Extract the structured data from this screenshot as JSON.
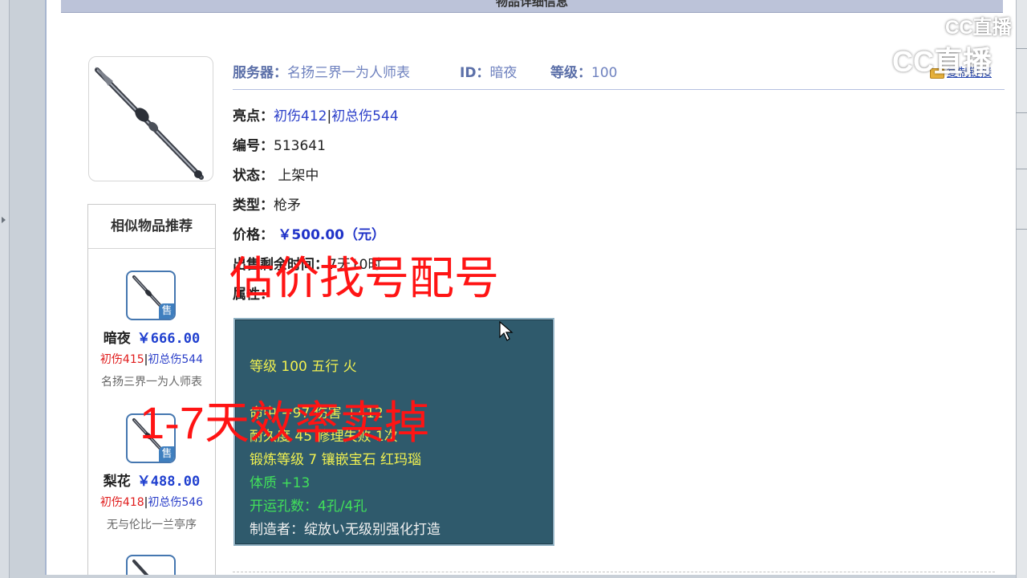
{
  "page": {
    "title": "物品详细信息"
  },
  "watermark": {
    "logo_small": "CC直播",
    "logo_large": "CC直播"
  },
  "header": {
    "server_label": "服务器：",
    "server_value": "名扬三界一为人师表",
    "id_label": "ID：",
    "id_value": "暗夜",
    "level_label": "等级：",
    "level_value": "100",
    "copy_link": "复制链接"
  },
  "details": {
    "highlight_label": "亮点：",
    "highlight_a": "初伤412",
    "highlight_sep": "|",
    "highlight_b": "初总伤544",
    "serial_label": "编号：",
    "serial_value": "513641",
    "status_label": "状态：",
    "status_value": "上架中",
    "type_label": "类型：",
    "type_value": "枪矛",
    "price_label": "价格：",
    "price_value": "￥500.00（元）",
    "remaining_label": "出售剩余时间：",
    "remaining_value": "7天10时",
    "attr_label": "属性："
  },
  "attributes": {
    "line1": "等级 100 五行 火",
    "line2": "命中 +97 伤害 +412",
    "line3": "耐久度 45 修理失败 1次",
    "line4": "锻炼等级 7 镶嵌宝石 红玛瑙",
    "line5": "体质 +13",
    "line6": "开运孔数：4孔/4孔",
    "line7": "制造者：绽放い无级别强化打造"
  },
  "similar": {
    "title": "相似物品推荐",
    "sale_badge": "售",
    "items": [
      {
        "name": "暗夜",
        "price": "￥666.00",
        "stat_a": "初伤415",
        "sep": "|",
        "stat_b": "初总伤544",
        "server": "名扬三界一为人师表"
      },
      {
        "name": "梨花",
        "price": "￥488.00",
        "stat_a": "初伤418",
        "sep": "|",
        "stat_b": "初总伤546",
        "server": "无与伦比一兰亭序"
      }
    ]
  },
  "overlay": {
    "text1": "估价找号配号",
    "text2": "1-7天效率卖掉"
  },
  "colors": {
    "overlay_red": "#ff1414",
    "price_blue": "#2033c8",
    "attr_bg": "#2f5a6c",
    "attr_yellow": "#f0f050",
    "attr_green": "#41e05a"
  }
}
